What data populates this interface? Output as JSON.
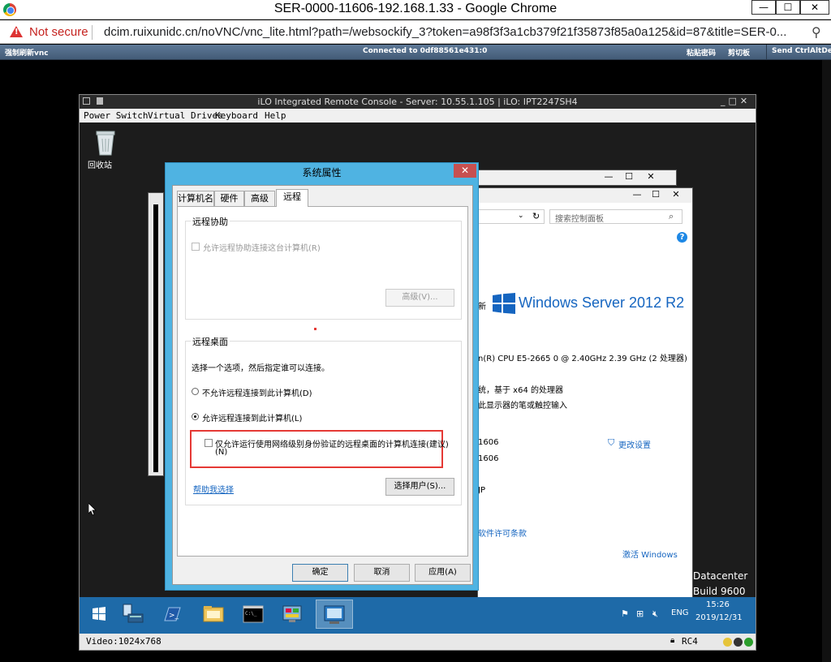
{
  "browser": {
    "window_title": "SER-0000-11606-192.168.1.33 - Google Chrome",
    "minimize": "—",
    "maximize": "☐",
    "close": "✕",
    "not_secure": "Not secure",
    "url": "dcim.ruixunidc.cn/noVNC/vnc_lite.html?path=/websockify_3?token=a98f3f3a1cb379f21f35873f85a0a125&id=87&title=SER-0...",
    "zoom_icon": "magnifier-icon"
  },
  "vnc": {
    "left_label": "强制刷新vnc",
    "status": "Connected to 0df88561e431:0",
    "paste": "粘贴密码",
    "clipboard": "剪切板",
    "send_cad": "Send CtrlAltDel"
  },
  "ilo": {
    "title": "iLO Integrated Remote Console - Server: 10.55.1.105 | iLO: IPT2247SH4",
    "menu": [
      "Power Switch",
      "Virtual Drives",
      "Keyboard",
      "Help"
    ],
    "video": "Video:1024x768",
    "cipher": "RC4"
  },
  "desktop": {
    "recycle_bin": "回收站"
  },
  "bgwindow": {
    "search_placeholder": "搜索控制面板",
    "brand": "Windows Server 2012 R2",
    "brand_prefix": "新",
    "cpu": "n(R) CPU E5-2665 0 @ 2.40GHz   2.39 GHz  (2 处理器)",
    "systype": "统，基于 x64 的处理器",
    "pen": "此显示器的笔或触控输入",
    "name1": "1606",
    "name2": "1606",
    "name3": "JP",
    "change": "更改设置",
    "license": "软件许可条款",
    "activate": "激活 Windows",
    "edition": "Datacenter",
    "build": "Build 9600"
  },
  "dialog": {
    "title": "系统属性",
    "tabs": [
      "计算机名",
      "硬件",
      "高级",
      "远程"
    ],
    "remote_assist_group": "远程协助",
    "allow_assist": "允许远程协助连接这台计算机(R)",
    "advanced_btn": "高级(V)...",
    "remote_desktop_group": "远程桌面",
    "choose_prompt": "选择一个选项，然后指定谁可以连接。",
    "radio_deny": "不允许远程连接到此计算机(D)",
    "radio_allow": "允许远程连接到此计算机(L)",
    "nla_line1": "仅允许运行使用网络级别身份验证的远程桌面的计算机连接(建议)",
    "nla_line2": "(N)",
    "help_link": "帮助我选择",
    "select_users": "选择用户(S)...",
    "ok": "确定",
    "cancel": "取消",
    "apply": "应用(A)"
  },
  "taskbar": {
    "lang": "ENG",
    "time": "15:26",
    "date": "2019/12/31"
  },
  "colors": {
    "dialog_frame": "#4fb3e2",
    "taskbar": "#1e6aa8",
    "highlight_box": "#e53935",
    "vnc_bar": "#4f6985"
  }
}
